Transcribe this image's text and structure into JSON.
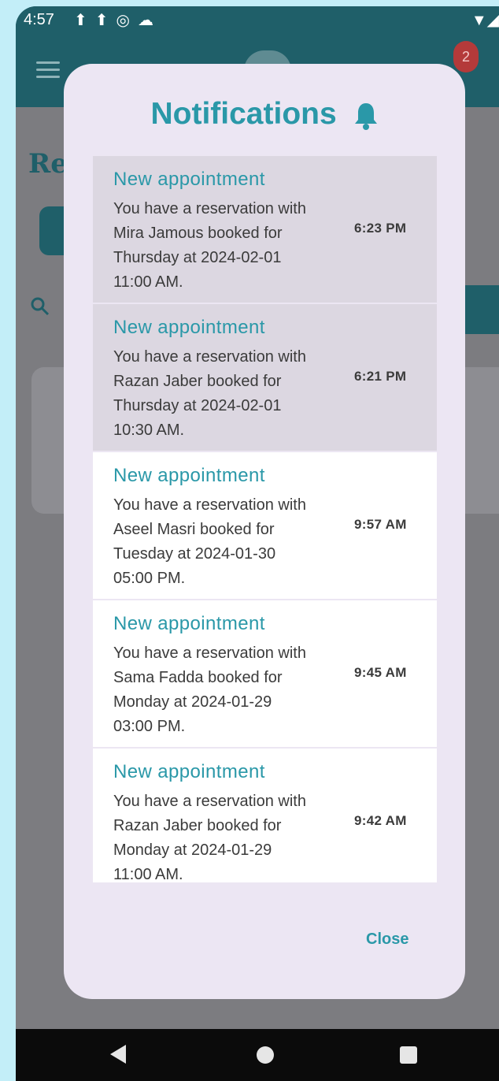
{
  "status": {
    "time": "4:57"
  },
  "app": {
    "page_title": "Re",
    "badge_count": "2"
  },
  "modal": {
    "title": "Notifications",
    "close_label": "Close",
    "items": [
      {
        "title": "New appointment",
        "body": "You have a reservation with\nMira Jamous booked for\nThursday at 2024-02-01\n11:00 AM.",
        "time": "6:23 PM",
        "state": "unread"
      },
      {
        "title": "New appointment",
        "body": "You have a reservation with\nRazan Jaber booked for\nThursday at 2024-02-01\n10:30 AM.",
        "time": "6:21 PM",
        "state": "unread"
      },
      {
        "title": "New appointment",
        "body": "You have a reservation with\nAseel Masri booked for\nTuesday at 2024-01-30\n05:00 PM.",
        "time": "9:57 AM",
        "state": "read"
      },
      {
        "title": "New appointment",
        "body": "You have a reservation with\nSama Fadda booked for\nMonday at 2024-01-29\n03:00 PM.",
        "time": "9:45 AM",
        "state": "read"
      },
      {
        "title": "New appointment",
        "body": "You have a reservation with\nRazan Jaber booked for\nMonday at 2024-01-29\n11:00 AM.",
        "time": "9:42 AM",
        "state": "read"
      }
    ]
  },
  "colors": {
    "accent": "#2a98a8",
    "modal_bg": "#ece6f3",
    "unread_bg": "#dcd7e1",
    "app_bar": "#1f5f69",
    "badge": "#b43a3a"
  },
  "icons": {
    "bell": "bell-icon",
    "menu": "menu-icon",
    "search": "search-icon",
    "back": "back-icon",
    "home": "home-icon",
    "recents": "recents-icon"
  }
}
